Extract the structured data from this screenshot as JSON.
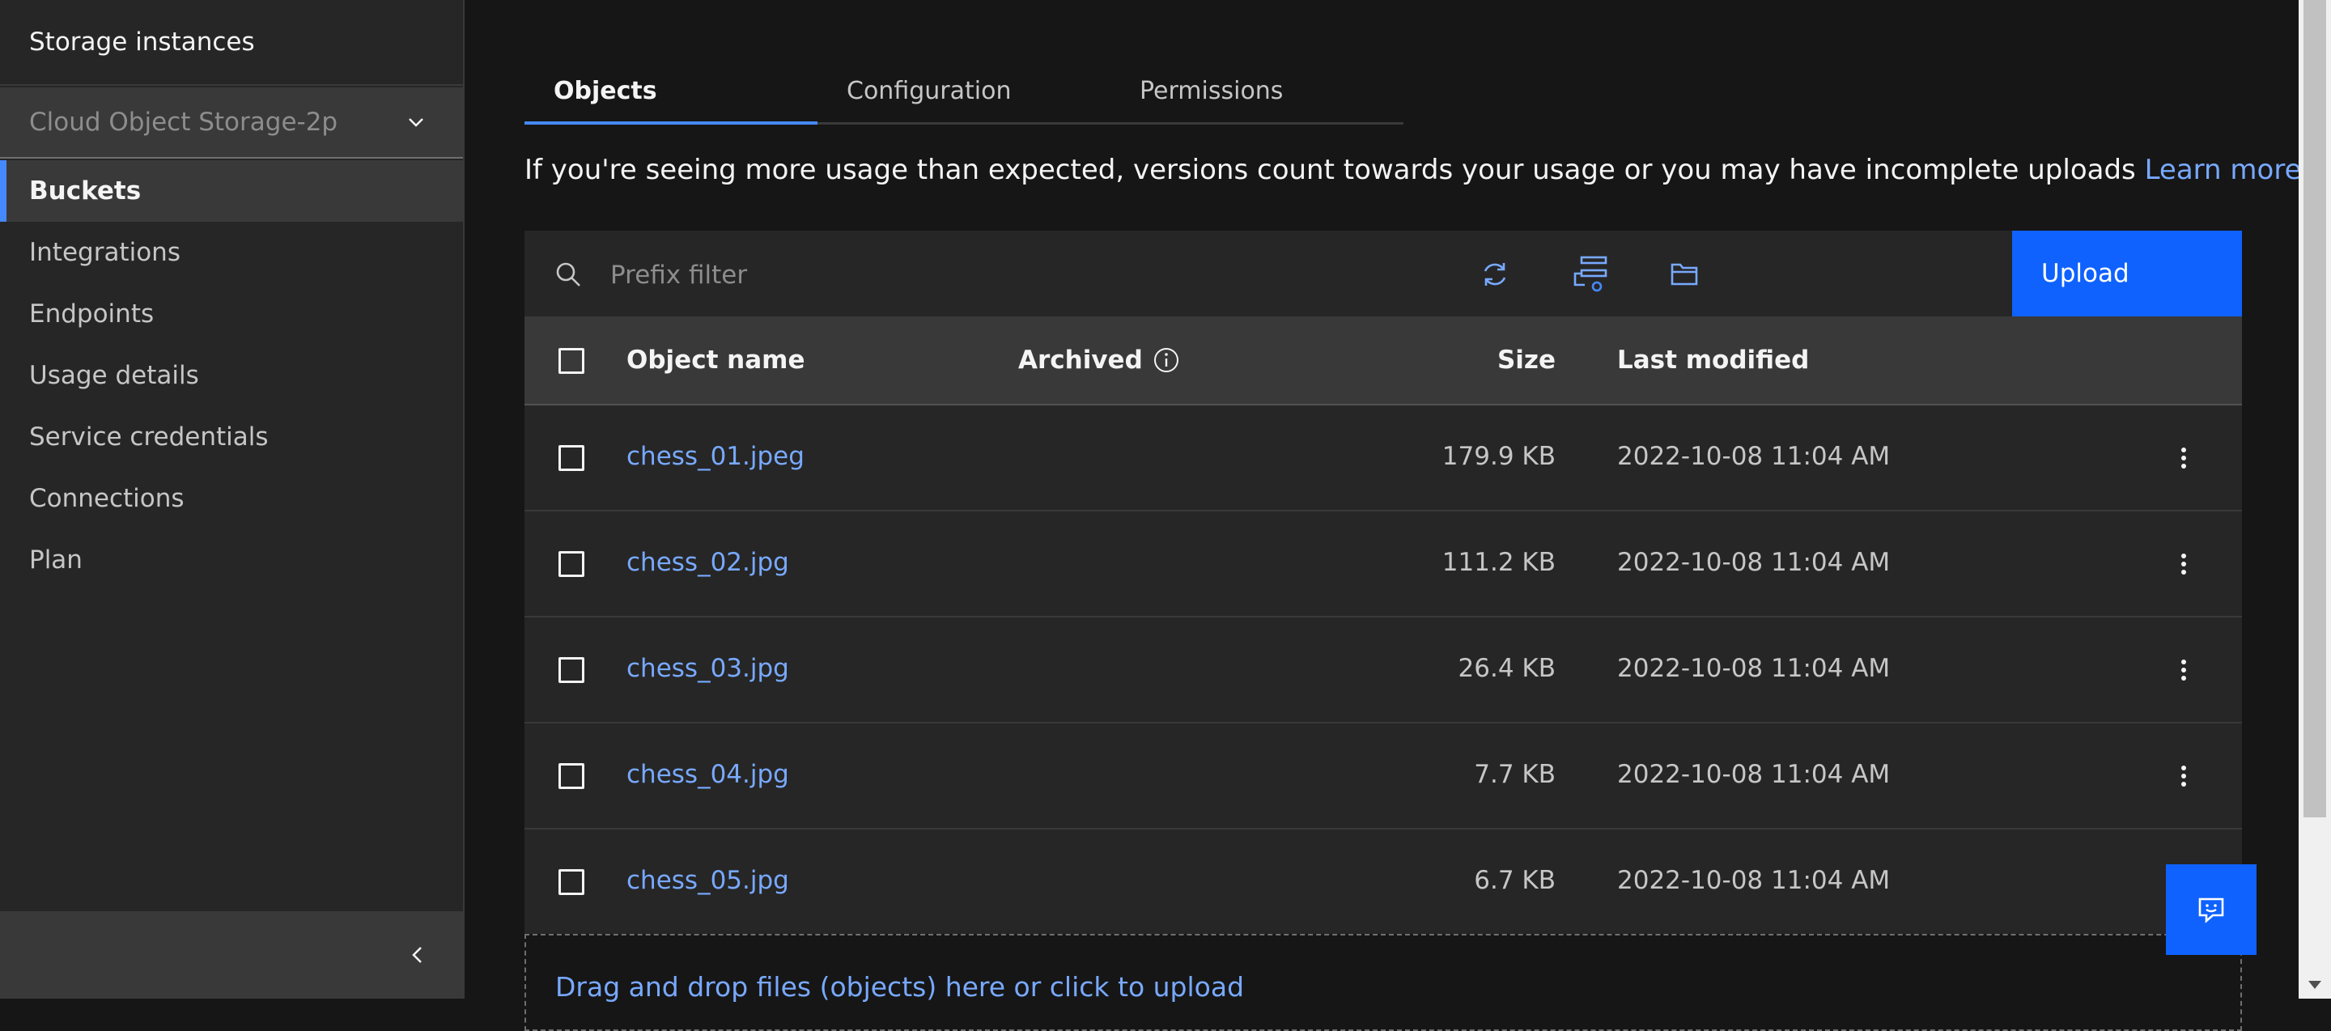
{
  "sidebar": {
    "top_link": "Storage instances",
    "instance_selector": "Cloud Object Storage-2p",
    "items": [
      {
        "label": "Buckets",
        "active": true
      },
      {
        "label": "Integrations"
      },
      {
        "label": "Endpoints"
      },
      {
        "label": "Usage details"
      },
      {
        "label": "Service credentials"
      },
      {
        "label": "Connections"
      },
      {
        "label": "Plan"
      }
    ],
    "collapse_icon": "chevron-left-icon"
  },
  "tabs": [
    {
      "label": "Objects",
      "active": true
    },
    {
      "label": "Configuration"
    },
    {
      "label": "Permissions"
    }
  ],
  "notice": {
    "text": "If you're seeing more usage than expected, versions count towards your usage or you may have incomplete uploads",
    "link": "Learn more"
  },
  "toolbar": {
    "search_placeholder": "Prefix filter",
    "icons": [
      "refresh-icon",
      "view-versions-icon",
      "new-folder-icon"
    ],
    "upload_label": "Upload"
  },
  "table": {
    "headers": {
      "name": "Object name",
      "archived": "Archived",
      "size": "Size",
      "modified": "Last modified"
    },
    "rows": [
      {
        "name": "chess_01.jpeg",
        "size": "179.9 KB",
        "modified": "2022-10-08 11:04 AM"
      },
      {
        "name": "chess_02.jpg",
        "size": "111.2 KB",
        "modified": "2022-10-08 11:04 AM"
      },
      {
        "name": "chess_03.jpg",
        "size": "26.4 KB",
        "modified": "2022-10-08 11:04 AM"
      },
      {
        "name": "chess_04.jpg",
        "size": "7.7 KB",
        "modified": "2022-10-08 11:04 AM"
      },
      {
        "name": "chess_05.jpg",
        "size": "6.7 KB",
        "modified": "2022-10-08 11:04 AM"
      }
    ]
  },
  "dropzone": {
    "label": "Drag and drop files (objects) here or click to upload"
  },
  "colors": {
    "accent": "#0f62fe",
    "link": "#78a9ff",
    "background": "#161616",
    "surface": "#262626"
  }
}
